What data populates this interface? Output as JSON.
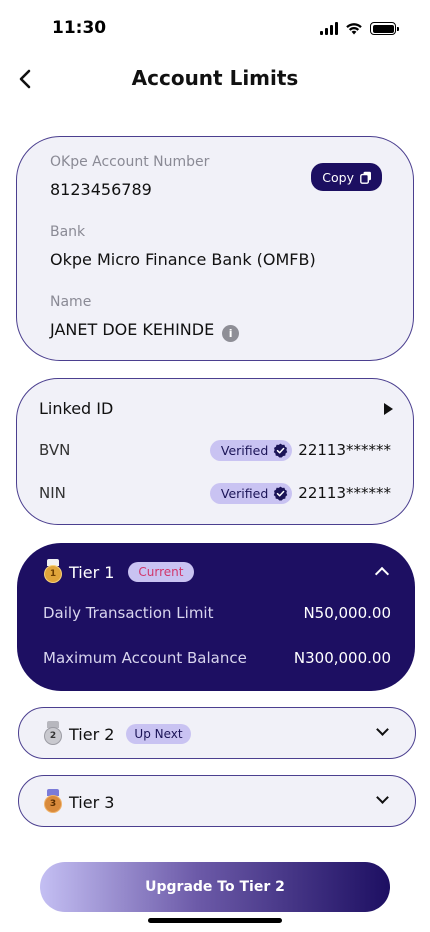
{
  "status_bar": {
    "time": "11:30"
  },
  "header": {
    "title": "Account Limits"
  },
  "account": {
    "number_label": "OKpe Account Number",
    "number": "8123456789",
    "copy_label": "Copy",
    "bank_label": "Bank",
    "bank": "Okpe Micro Finance Bank (OMFB)",
    "name_label": "Name",
    "name": "JANET DOE KEHINDE"
  },
  "linked_id": {
    "title": "Linked ID",
    "items": [
      {
        "label": "BVN",
        "status": "Verified",
        "value": "22113******"
      },
      {
        "label": "NIN",
        "status": "Verified",
        "value": "22113******"
      }
    ]
  },
  "tiers": [
    {
      "name": "Tier 1",
      "medal_number": "1",
      "badge": "Current",
      "expanded": true,
      "limits": [
        {
          "label": "Daily Transaction Limit",
          "amount": "N50,000.00"
        },
        {
          "label": "Maximum Account Balance",
          "amount": "N300,000.00"
        }
      ]
    },
    {
      "name": "Tier 2",
      "medal_number": "2",
      "badge": "Up Next",
      "expanded": false
    },
    {
      "name": "Tier 3",
      "medal_number": "3",
      "badge": "",
      "expanded": false
    }
  ],
  "upgrade_label": "Upgrade To Tier 2",
  "colors": {
    "primary": "#1d0f62",
    "badge_bg": "#c9c3f2",
    "card_bg": "#f1f1f8",
    "current_text": "#d1366b",
    "gold": "#e0a53a",
    "silver": "#9c9ca4",
    "bronze": "#c97d3a"
  },
  "icons": {
    "back": "back-arrow-icon",
    "copy": "copy-icon",
    "info": "info-icon",
    "linked_arrow": "play-arrow-icon",
    "verified": "verified-check-icon",
    "collapse": "chevron-up-icon",
    "expand": "chevron-down-icon"
  }
}
